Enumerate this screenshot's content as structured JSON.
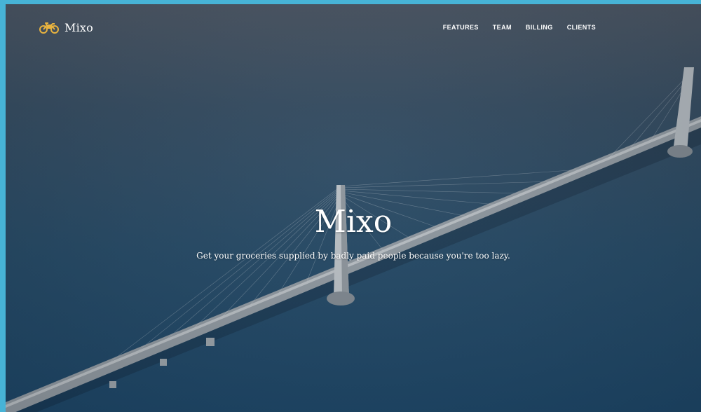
{
  "navbar": {
    "brand_name": "Mixo",
    "brand_icon": "motorcycle-icon",
    "links": [
      {
        "label": "FEATURES"
      },
      {
        "label": "TEAM"
      },
      {
        "label": "BILLING"
      },
      {
        "label": "CLIENTS"
      }
    ]
  },
  "hero": {
    "title": "Mixo",
    "subtitle": "Get your groceries supplied by badly paid people because you're too lazy."
  },
  "colors": {
    "accent": "#e8b33f",
    "page_border": "#47b3d6",
    "text": "#ffffff"
  }
}
